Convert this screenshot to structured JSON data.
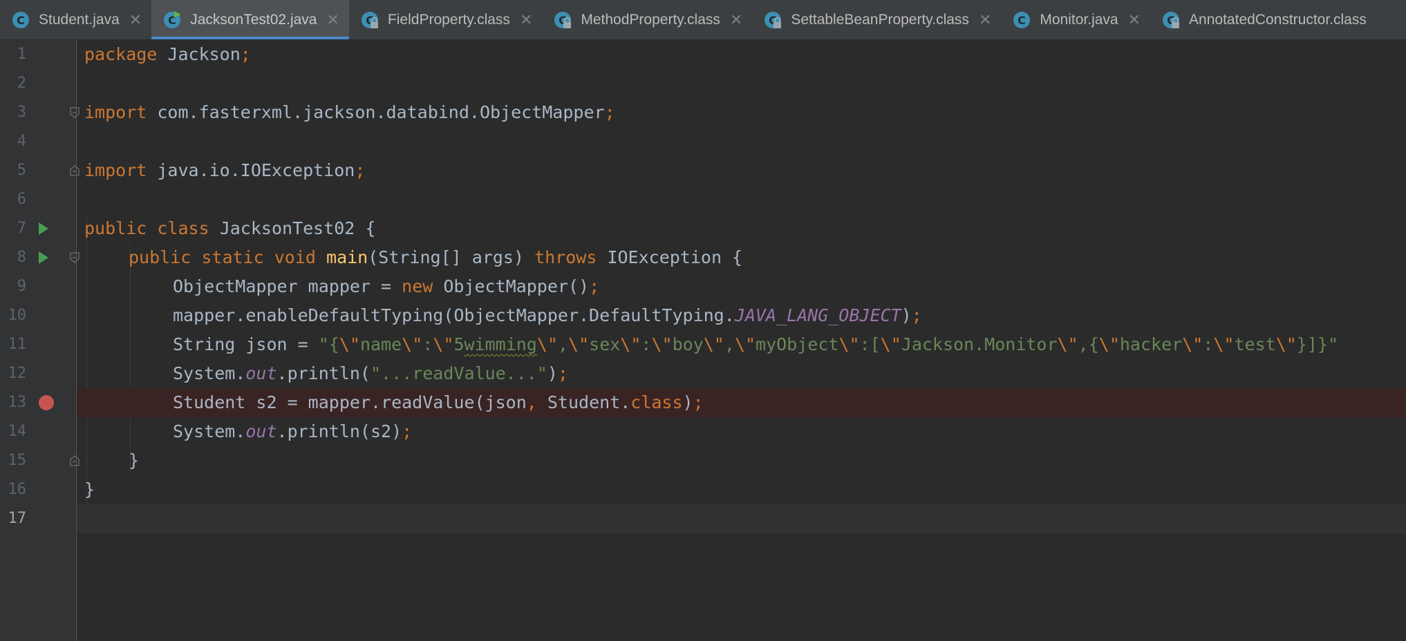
{
  "tabs": [
    {
      "label": "Student.java",
      "icon": "class-icon",
      "close": "✕",
      "active": false
    },
    {
      "label": "JacksonTest02.java",
      "icon": "class-run-icon",
      "close": "✕",
      "active": true
    },
    {
      "label": "FieldProperty.class",
      "icon": "class-locked-icon",
      "close": "✕",
      "active": false
    },
    {
      "label": "MethodProperty.class",
      "icon": "class-locked-icon",
      "close": "✕",
      "active": false
    },
    {
      "label": "SettableBeanProperty.class",
      "icon": "class-locked-icon",
      "close": "✕",
      "active": false
    },
    {
      "label": "Monitor.java",
      "icon": "class-icon",
      "close": "✕",
      "active": false
    },
    {
      "label": "AnnotatedConstructor.class",
      "icon": "class-locked-icon",
      "close": "",
      "active": false
    }
  ],
  "gutter": {
    "line_numbers": [
      "1",
      "2",
      "3",
      "4",
      "5",
      "6",
      "7",
      "8",
      "9",
      "10",
      "11",
      "12",
      "13",
      "14",
      "15",
      "16",
      "17"
    ]
  },
  "code": {
    "l1": [
      "package",
      " Jackson",
      ";"
    ],
    "l3": [
      "import",
      " com.fasterxml.jackson.databind.ObjectMapper",
      ";"
    ],
    "l5": [
      "import",
      " java.io.IOException",
      ";"
    ],
    "l7": [
      "public",
      " ",
      "class",
      " JacksonTest02 {"
    ],
    "l8": [
      "public",
      " ",
      "static",
      " ",
      "void",
      " ",
      "main",
      "(String[] args) ",
      "throws",
      " IOException {"
    ],
    "l9": [
      "ObjectMapper mapper = ",
      "new",
      " ObjectMapper()",
      ";"
    ],
    "l10": [
      "mapper.enableDefaultTyping(ObjectMapper.DefaultTyping.",
      "JAVA_LANG_OBJECT",
      ")",
      ";"
    ],
    "l11": [
      "String json = ",
      "\"{",
      "\\\"",
      "name",
      "\\\"",
      ":",
      "\\\"",
      "5",
      "wimming",
      "\\\"",
      ",",
      "\\\"",
      "sex",
      "\\\"",
      ":",
      "\\\"",
      "boy",
      "\\\"",
      ",",
      "\\\"",
      "myObject",
      "\\\"",
      ":[",
      "\\\"",
      "Jackson.Monitor",
      "\\\"",
      ",{",
      "\\\"",
      "hacker",
      "\\\"",
      ":",
      "\\\"",
      "test",
      "\\\"",
      "}]}\""
    ],
    "l12": [
      "System.",
      "out",
      ".println(",
      "\"...readValue...\"",
      ")",
      ";"
    ],
    "l13": [
      "Student s2 = mapper.readValue(json",
      ",",
      " Student.",
      "class",
      ")",
      ";"
    ],
    "l14": [
      "System.",
      "out",
      ".println(s2)",
      ";"
    ],
    "l15": [
      "}"
    ],
    "l16": [
      "}"
    ]
  },
  "colors": {
    "background": "#2b2b2b",
    "keyword": "#cc7832",
    "string": "#6a8759",
    "function": "#ffc66d",
    "field": "#9876aa",
    "text": "#a9b7c6",
    "breakpoint": "#c75450",
    "run": "#499c54",
    "active_tab_underline": "#4a88c7"
  }
}
